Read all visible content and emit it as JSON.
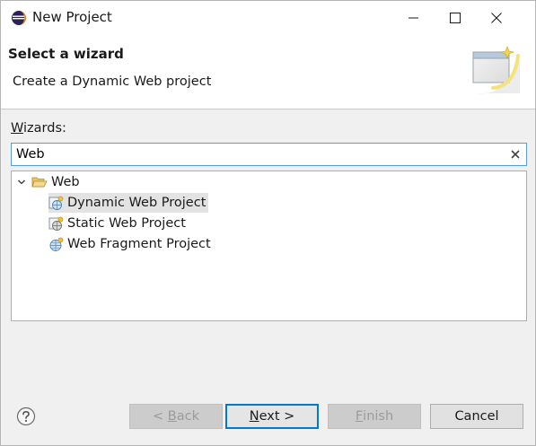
{
  "window": {
    "title": "New Project"
  },
  "banner": {
    "title": "Select a wizard",
    "description": "Create a Dynamic Web project"
  },
  "wizards": {
    "label_prefix": "W",
    "label_rest": "izards:",
    "filter_value": "Web"
  },
  "tree": {
    "category": "Web",
    "items": [
      {
        "label": "Dynamic Web Project",
        "selected": true
      },
      {
        "label": "Static Web Project",
        "selected": false
      },
      {
        "label": "Web Fragment Project",
        "selected": false
      }
    ]
  },
  "buttons": {
    "back_pre": "< ",
    "back_mn": "B",
    "back_post": "ack",
    "next_mn": "N",
    "next_post": "ext >",
    "finish_mn": "F",
    "finish_post": "inish",
    "cancel": "Cancel"
  },
  "colors": {
    "focus_border": "#0078d7",
    "selection": "#e3e3e3"
  }
}
